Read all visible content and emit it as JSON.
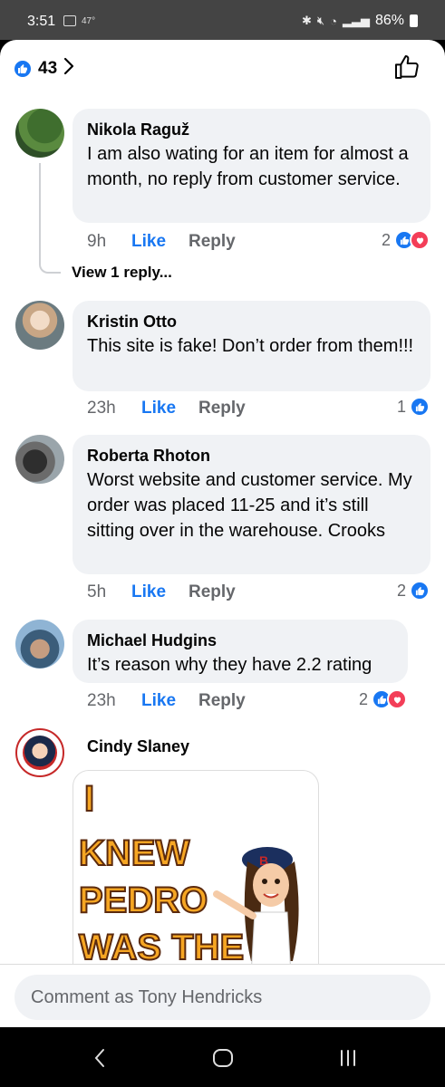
{
  "status_bar": {
    "time": "3:51",
    "temperature": "47°",
    "battery": "86%"
  },
  "header": {
    "reaction_count": "43"
  },
  "comments": [
    {
      "author": "Nikola Raguž",
      "text": "I am also wating for an item for almost a month, no reply from customer service.",
      "time": "9h",
      "like_label": "Like",
      "reply_label": "Reply",
      "reaction_count": "2",
      "reactions": [
        "like",
        "love"
      ],
      "view_replies": "View 1 reply..."
    },
    {
      "author": "Kristin Otto",
      "text": "This site is fake! Don’t order from them!!!",
      "time": "23h",
      "like_label": "Like",
      "reply_label": "Reply",
      "reaction_count": "1",
      "reactions": [
        "like"
      ]
    },
    {
      "author": "Roberta Rhoton",
      "text": "Worst website and customer service. My order was placed 11-25 and it’s still sitting over in the warehouse. Crooks",
      "time": "5h",
      "like_label": "Like",
      "reply_label": "Reply",
      "reaction_count": "2",
      "reactions": [
        "like"
      ]
    },
    {
      "author": "Michael Hudgins",
      "text": "It’s reason why they have 2.2 rating",
      "time": "23h",
      "like_label": "Like",
      "reply_label": "Reply",
      "reaction_count": "2",
      "reactions": [
        "like",
        "love"
      ]
    },
    {
      "author": "Cindy Slaney",
      "sticker_text": [
        "I",
        "KNEW",
        "PEDRO",
        "WAS THE"
      ]
    }
  ],
  "composer": {
    "placeholder": "Comment as Tony Hendricks"
  },
  "colors": {
    "accent": "#1877f2",
    "love": "#f33e58",
    "bubble": "#f0f2f5",
    "secondary_text": "#65676b"
  }
}
